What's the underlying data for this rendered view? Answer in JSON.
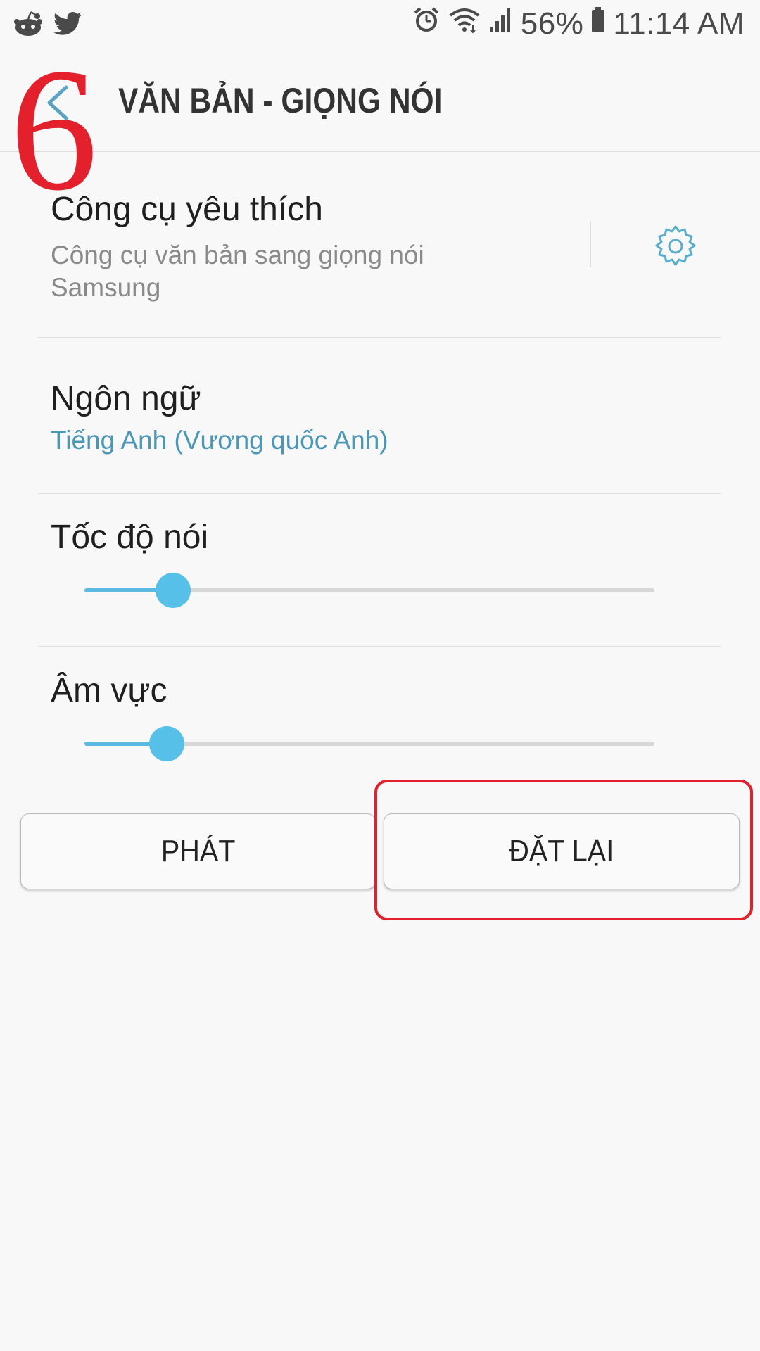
{
  "status_bar": {
    "left_icons": [
      "reddit-icon",
      "twitter-icon"
    ],
    "right_icons": [
      "alarm-icon",
      "wifi-icon",
      "signal-icon",
      "battery-icon"
    ],
    "battery_percent": "56%",
    "time": "11:14 AM"
  },
  "header": {
    "title": "VĂN BẢN - GIỌNG NÓI",
    "back_icon": "chevron-left-icon"
  },
  "annotation": {
    "step": "6",
    "color": "#e3202b"
  },
  "settings": {
    "preferred_engine": {
      "title": "Công cụ yêu thích",
      "subtitle": "Công cụ văn bản sang giọng nói Samsung",
      "action_icon": "gear-icon"
    },
    "language": {
      "title": "Ngôn ngữ",
      "value": "Tiếng Anh (Vương quốc Anh)"
    },
    "speech_rate": {
      "title": "Tốc độ nói",
      "level": 0.155
    },
    "pitch": {
      "title": "Âm vực",
      "level": 0.145
    }
  },
  "buttons": {
    "play_label": "PHÁT",
    "reset_label": "ĐẶT LẠI"
  },
  "colors": {
    "accent": "#57c0e8",
    "link_blue": "#4b97b7",
    "annotation_red": "#e3202b"
  }
}
